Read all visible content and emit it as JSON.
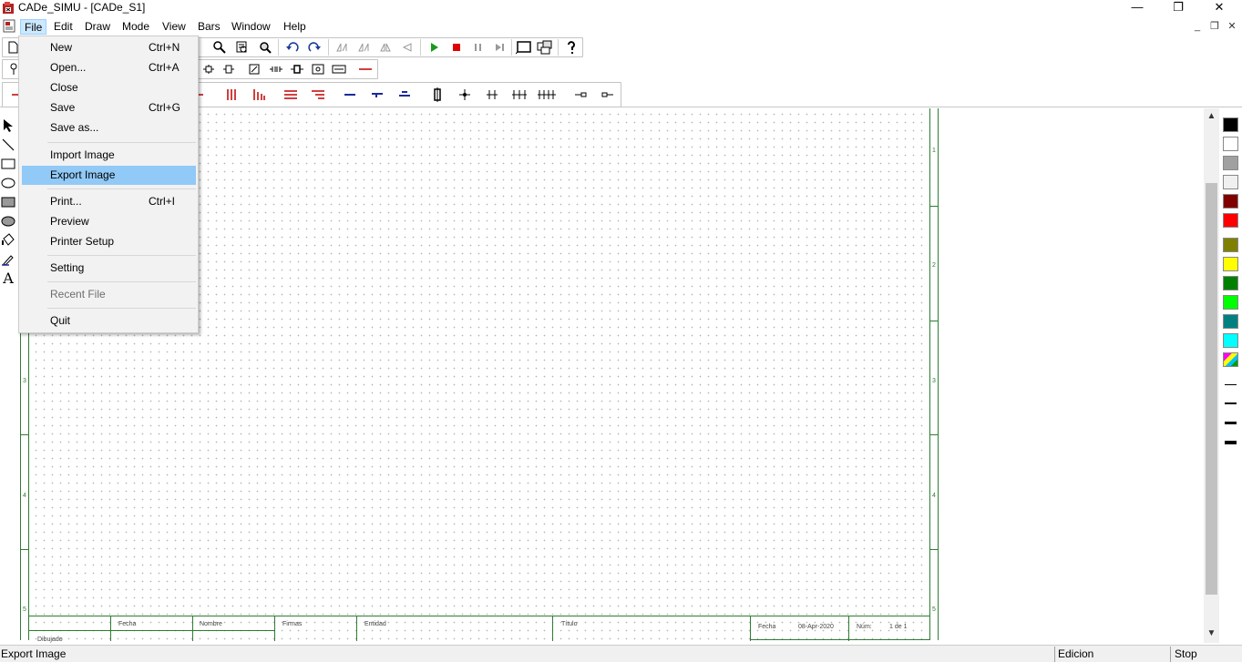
{
  "window": {
    "title": "CADe_SIMU - [CADe_S1]",
    "controls": {
      "minimize": "—",
      "restore": "❐",
      "close": "✕"
    }
  },
  "menubar": {
    "items": [
      "File",
      "Edit",
      "Draw",
      "Mode",
      "View",
      "Bars",
      "Window",
      "Help"
    ],
    "open_item": "File"
  },
  "file_menu": {
    "items": [
      {
        "label": "New",
        "shortcut": "Ctrl+N"
      },
      {
        "label": "Open...",
        "shortcut": "Ctrl+A"
      },
      {
        "label": "Close",
        "shortcut": ""
      },
      {
        "label": "Save",
        "shortcut": "Ctrl+G"
      },
      {
        "label": "Save as...",
        "shortcut": ""
      },
      {
        "label": "Import Image",
        "shortcut": ""
      },
      {
        "label": "Export Image",
        "shortcut": "",
        "highlighted": true
      },
      {
        "label": "Print...",
        "shortcut": "Ctrl+I"
      },
      {
        "label": "Preview",
        "shortcut": ""
      },
      {
        "label": "Printer Setup",
        "shortcut": ""
      },
      {
        "label": "Setting",
        "shortcut": ""
      },
      {
        "label": "Recent File",
        "shortcut": "",
        "disabled": true
      },
      {
        "label": "Quit",
        "shortcut": ""
      }
    ]
  },
  "sheet": {
    "row_numbers": [
      "1",
      "2",
      "3",
      "4",
      "5"
    ],
    "title_block": {
      "fecha_label": "Fecha",
      "nombre_label": "Nombre",
      "firmas_label": "Firmas",
      "entidad_label": "Entidad",
      "titulo_label": "Título",
      "fecha2_label": "Fecha",
      "date_value": "08-Apr-2020",
      "num_label": "Núm:",
      "page_value": "1 de 1",
      "dibujado_label": "Dibujado"
    }
  },
  "palette": {
    "colors": [
      "#000000",
      "#ffffff",
      "#a0a0a0",
      "#f0f0f0",
      "#800000",
      "#ff0000",
      "#808000",
      "#ffff00",
      "#008000",
      "#00ff00",
      "#008080",
      "#00ffff"
    ],
    "line_widths": [
      "thin",
      "medium",
      "thick",
      "thicker"
    ]
  },
  "statusbar": {
    "left_text": "Export Image",
    "mode_text": "Edicion",
    "sim_text": "Stop"
  }
}
